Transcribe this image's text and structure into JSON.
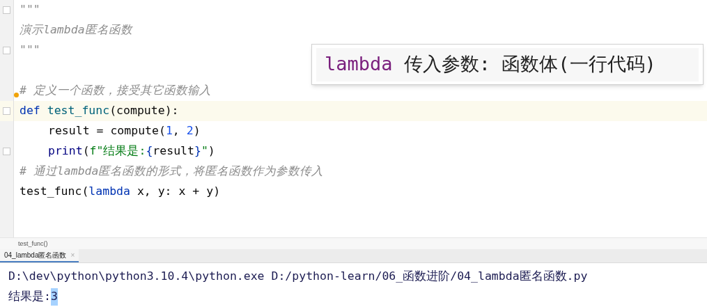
{
  "editor": {
    "lines": [
      {
        "fold": true,
        "highlighted": false,
        "indent": false,
        "tokens": [
          {
            "kind": "docstring",
            "text": "\"\"\""
          }
        ]
      },
      {
        "fold": false,
        "highlighted": false,
        "indent": false,
        "tokens": [
          {
            "kind": "docstring",
            "text": "演示lambda匿名函数"
          }
        ]
      },
      {
        "fold": true,
        "highlighted": false,
        "indent": false,
        "tokens": [
          {
            "kind": "docstring",
            "text": "\"\"\""
          }
        ]
      },
      {
        "fold": false,
        "highlighted": false
      },
      {
        "fold": false,
        "highlighted": false,
        "indent": false,
        "bulb": true,
        "tokens": [
          {
            "kind": "comment",
            "text": "# 定义一个函数，接受其它函数输入"
          }
        ]
      },
      {
        "fold": true,
        "highlighted": true,
        "indent": false,
        "tokens": [
          {
            "kind": "keyword",
            "text": "def"
          },
          {
            "kind": "function",
            "text": " test_func"
          },
          {
            "kind": "plain",
            "text": "(compute):"
          }
        ]
      },
      {
        "fold": false,
        "highlighted": false,
        "indent": true,
        "tokens": [
          {
            "kind": "plain",
            "text": "result = compute("
          },
          {
            "kind": "number",
            "text": "1"
          },
          {
            "kind": "plain",
            "text": ", "
          },
          {
            "kind": "number",
            "text": "2"
          },
          {
            "kind": "plain",
            "text": ")"
          }
        ]
      },
      {
        "fold": true,
        "highlighted": false,
        "indent": true,
        "tokens": [
          {
            "kind": "builtin",
            "text": "print"
          },
          {
            "kind": "plain",
            "text": "("
          },
          {
            "kind": "string",
            "text": "f\"结果是:"
          },
          {
            "kind": "keyword",
            "text": "{"
          },
          {
            "kind": "plain",
            "text": "result"
          },
          {
            "kind": "keyword",
            "text": "}"
          },
          {
            "kind": "string",
            "text": "\""
          },
          {
            "kind": "plain",
            "text": ")"
          }
        ]
      },
      {
        "fold": false,
        "highlighted": false,
        "indent": false,
        "tokens": [
          {
            "kind": "comment",
            "text": "# 通过lambda匿名函数的形式，将匿名函数作为参数传入"
          }
        ]
      },
      {
        "fold": false,
        "highlighted": false,
        "indent": false,
        "tokens": [
          {
            "kind": "plain",
            "text": "test_func("
          },
          {
            "kind": "keyword",
            "text": "lambda"
          },
          {
            "kind": "plain",
            "text": " x, y: x + y)"
          }
        ]
      }
    ]
  },
  "tooltip": {
    "keyword": "lambda",
    "text": "传入参数: 函数体(一行代码)"
  },
  "breadcrumb": "test_func()",
  "run_tabs": [
    {
      "label": "04_lambda匿名函数",
      "close": "×",
      "selected": true
    }
  ],
  "console": {
    "lines": [
      [
        {
          "text": "D:\\dev\\python\\python3.10.4\\python.exe D:/python-learn/06_函数进阶/04_lambda匿名函数.py",
          "selected": false
        }
      ],
      [
        {
          "text": "结果是:",
          "selected": false
        },
        {
          "text": "3",
          "selected": true
        }
      ]
    ]
  }
}
